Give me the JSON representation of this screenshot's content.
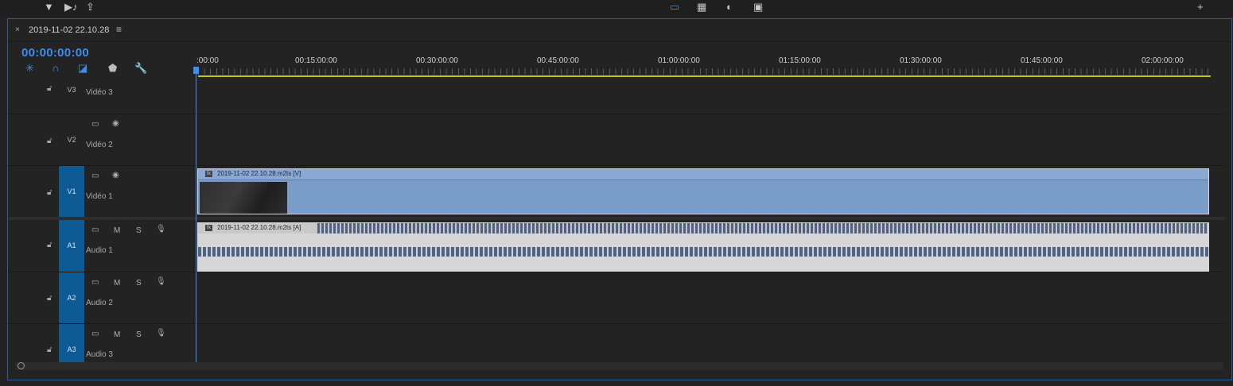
{
  "toolbar": {
    "filter_icon": "funnel-icon",
    "audio_icon": "audio-clip-icon",
    "export_icon": "export-icon"
  },
  "sequence": {
    "close": "×",
    "name": "2019-11-02 22.10.28",
    "menu": "≡",
    "timecode": "00:00:00:00"
  },
  "ruler": {
    "labels": [
      ":00:00",
      "00:15:00:00",
      "00:30:00:00",
      "00:45:00:00",
      "01:00:00:00",
      "01:15:00:00",
      "01:30:00:00",
      "01:45:00:00",
      "02:00:00:00"
    ]
  },
  "tracks": [
    {
      "id": "V3",
      "name": "Vidéo 3"
    },
    {
      "id": "V2",
      "name": "Vidéo 2"
    },
    {
      "id": "V1",
      "name": "Vidéo 1"
    },
    {
      "id": "A1",
      "name": "Audio 1",
      "m": "M",
      "s": "S"
    },
    {
      "id": "A2",
      "name": "Audio 2",
      "m": "M",
      "s": "S"
    },
    {
      "id": "A3",
      "name": "Audio 3",
      "m": "M",
      "s": "S"
    }
  ],
  "clips": {
    "video": {
      "label": "2019-11-02 22.10.28.m2ts [V]",
      "fx": "fx"
    },
    "audio": {
      "label": "2019-11-02 22.10.28.m2ts [A]",
      "fx": "fx"
    }
  },
  "colors": {
    "accent": "#3d8ee8",
    "track_target": "#0e5a95",
    "clip_video": "#7a9cc9",
    "workbar": "#c9c21a"
  }
}
